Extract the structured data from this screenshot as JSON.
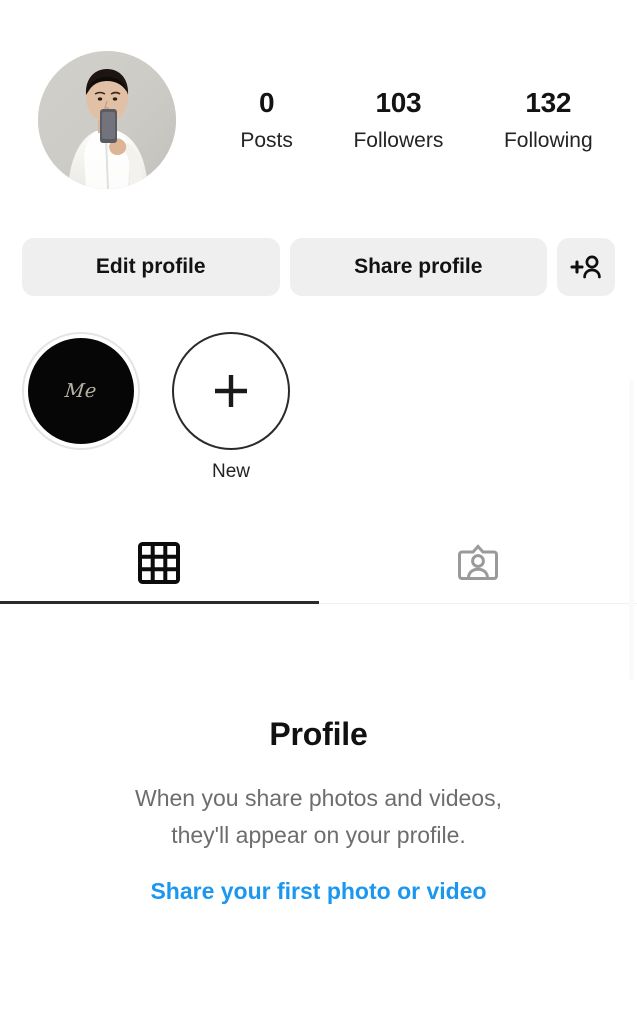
{
  "profile": {
    "avatar": {
      "icon": "profile-avatar",
      "description": "Person in white shirt taking a mirror selfie"
    },
    "stats": [
      {
        "value": "0",
        "label": "Posts"
      },
      {
        "value": "103",
        "label": "Followers"
      },
      {
        "value": "132",
        "label": "Following"
      }
    ]
  },
  "actions": {
    "edit_label": "Edit profile",
    "share_label": "Share profile",
    "discover_icon": "add-person-icon"
  },
  "highlights": [
    {
      "cover_text": "Me",
      "label": "",
      "type": "highlight"
    },
    {
      "cover_text": "+",
      "label": "New",
      "type": "new"
    }
  ],
  "tabs": [
    {
      "name": "grid",
      "icon": "grid-icon",
      "active": true
    },
    {
      "name": "tagged",
      "icon": "tagged-person-icon",
      "active": false
    }
  ],
  "empty_state": {
    "title": "Profile",
    "body_line1": "When you share photos and videos,",
    "body_line2": "they'll appear on your profile.",
    "link": "Share your first photo or video"
  },
  "colors": {
    "link_blue": "#1b97f0",
    "button_gray": "#efefef",
    "text_primary": "#111111",
    "text_secondary": "#6d6d6d",
    "tab_active": "#2b2b2b",
    "tab_inactive": "#9a9a9a"
  }
}
